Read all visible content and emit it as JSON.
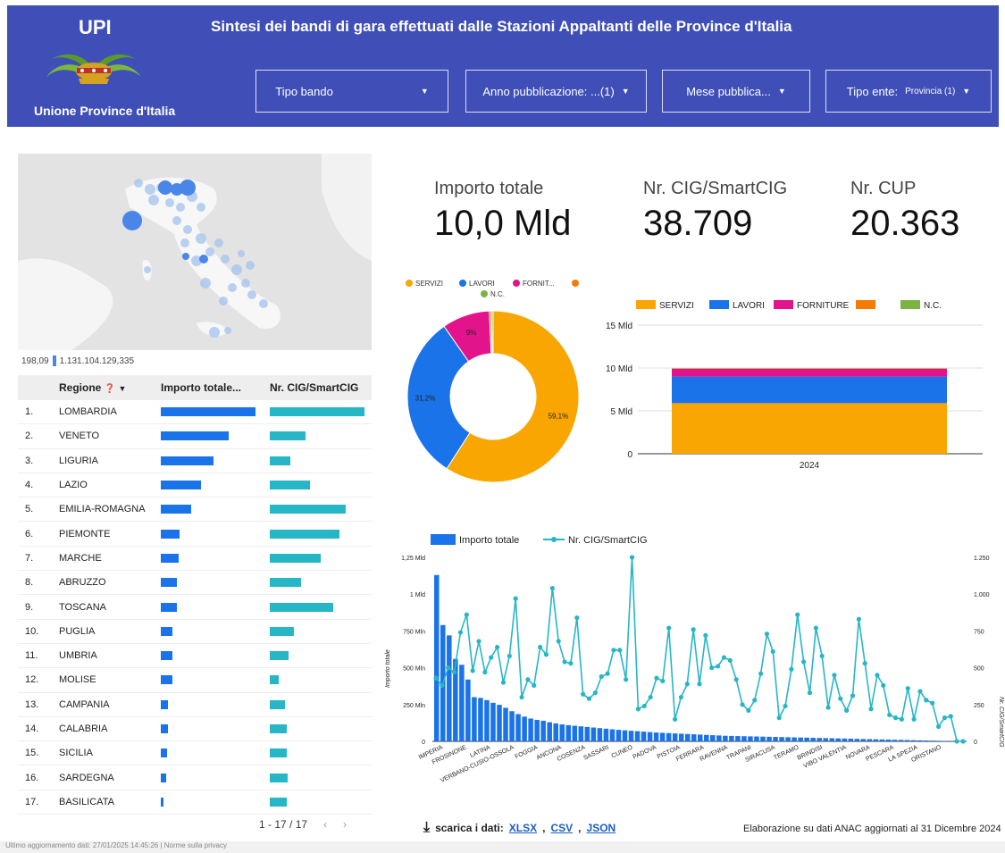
{
  "header": {
    "logo": "UPI",
    "logo_sub": "Unione Province d'Italia",
    "title": "Sintesi dei bandi di gara effettuati dalle Stazioni Appaltanti delle Province d'Italia",
    "filters": [
      {
        "label": "Tipo bando",
        "value": ""
      },
      {
        "label": "Anno pubblicazione: ...(1)",
        "value": ""
      },
      {
        "label": "Mese pubblica...",
        "value": ""
      },
      {
        "label": "Tipo ente:",
        "value": "Provincia (1)"
      }
    ]
  },
  "map": {
    "scale_min": "198,09",
    "scale_max": "1.131.104.129,335"
  },
  "table": {
    "headers": [
      "Regione",
      "Importo totale...",
      "Nr. CIG/SmartCIG"
    ],
    "rows": [
      {
        "n": "1.",
        "regione": "LOMBARDIA",
        "imp": 1.0,
        "cig": 1.0
      },
      {
        "n": "2.",
        "regione": "VENETO",
        "imp": 0.72,
        "cig": 0.38
      },
      {
        "n": "3.",
        "regione": "LIGURIA",
        "imp": 0.56,
        "cig": 0.22
      },
      {
        "n": "4.",
        "regione": "LAZIO",
        "imp": 0.42,
        "cig": 0.42
      },
      {
        "n": "5.",
        "regione": "EMILIA-ROMAGNA",
        "imp": 0.32,
        "cig": 0.8
      },
      {
        "n": "6.",
        "regione": "PIEMONTE",
        "imp": 0.2,
        "cig": 0.74
      },
      {
        "n": "7.",
        "regione": "MARCHE",
        "imp": 0.19,
        "cig": 0.54
      },
      {
        "n": "8.",
        "regione": "ABRUZZO",
        "imp": 0.17,
        "cig": 0.33
      },
      {
        "n": "9.",
        "regione": "TOSCANA",
        "imp": 0.17,
        "cig": 0.67
      },
      {
        "n": "10.",
        "regione": "PUGLIA",
        "imp": 0.12,
        "cig": 0.25
      },
      {
        "n": "11.",
        "regione": "UMBRIA",
        "imp": 0.12,
        "cig": 0.2
      },
      {
        "n": "12.",
        "regione": "MOLISE",
        "imp": 0.12,
        "cig": 0.09
      },
      {
        "n": "13.",
        "regione": "CAMPANIA",
        "imp": 0.08,
        "cig": 0.16
      },
      {
        "n": "14.",
        "regione": "CALABRIA",
        "imp": 0.08,
        "cig": 0.18
      },
      {
        "n": "15.",
        "regione": "SICILIA",
        "imp": 0.07,
        "cig": 0.18
      },
      {
        "n": "16.",
        "regione": "SARDEGNA",
        "imp": 0.06,
        "cig": 0.19
      },
      {
        "n": "17.",
        "regione": "BASILICATA",
        "imp": 0.03,
        "cig": 0.18
      }
    ],
    "pager": "1 - 17 / 17"
  },
  "kpis": [
    {
      "label": "Importo totale",
      "value": "10,0 Mld"
    },
    {
      "label": "Nr. CIG/SmartCIG",
      "value": "38.709"
    },
    {
      "label": "Nr. CUP",
      "value": "20.363"
    }
  ],
  "colors": {
    "servizi": "#f9a602",
    "lavori": "#1a73e8",
    "forniture": "#e3148b",
    "other": "#f57c00",
    "nc": "#7cb342",
    "teal": "#26b6c6",
    "header": "#3f4fb7"
  },
  "chart_data": [
    {
      "type": "pie",
      "legend": [
        "SERVIZI",
        "LAVORI",
        "FORNIT...",
        "",
        "N.C."
      ],
      "slices": [
        {
          "name": "SERVIZI",
          "value": 59.1,
          "label": "59,1%"
        },
        {
          "name": "LAVORI",
          "value": 31.2,
          "label": "31,2%"
        },
        {
          "name": "FORNITURE",
          "value": 9.0,
          "label": "9%"
        },
        {
          "name": "",
          "value": 0.4,
          "label": ""
        },
        {
          "name": "N.C.",
          "value": 0.3,
          "label": ""
        }
      ]
    },
    {
      "type": "bar",
      "legend": [
        "SERVIZI",
        "LAVORI",
        "FORNITURE",
        "",
        "N.C."
      ],
      "categories": [
        "2024"
      ],
      "series": [
        {
          "name": "SERVIZI",
          "values": [
            5.9
          ]
        },
        {
          "name": "LAVORI",
          "values": [
            3.1
          ]
        },
        {
          "name": "FORNITURE",
          "values": [
            0.9
          ]
        },
        {
          "name": "",
          "values": [
            0.04
          ]
        },
        {
          "name": "N.C.",
          "values": [
            0.03
          ]
        }
      ],
      "yticks": [
        "0",
        "5 Mld",
        "10 Mld",
        "15 Mld"
      ],
      "ylim": [
        0,
        15
      ]
    },
    {
      "type": "bar",
      "legend": [
        "Importo totale",
        "Nr. CIG/SmartCIG"
      ],
      "ylabel": "Importo totale",
      "y2label": "Nr. CIG/SmartCIG",
      "yticks": [
        "0",
        "250 Mln",
        "500 Mln",
        "750 Mln",
        "1 Mld",
        "1,25 Mld"
      ],
      "y2ticks": [
        "0",
        "250",
        "500",
        "750",
        "1.000",
        "1.250"
      ],
      "xlabels": [
        "IMPERIA",
        "FROSINONE",
        "LATINA",
        "VERBANO-CUSIO-OSSOLA",
        "FOGGIA",
        "ANCONA",
        "COSENZA",
        "SASSARI",
        "CUNEO",
        "PADOVA",
        "PISTOIA",
        "FERRARA",
        "RAVENNA",
        "TRAPANI",
        "SIRACUSA",
        "TERAMO",
        "BRINDISI",
        "VIBO VALENTIA",
        "NOVARA",
        "PESCARA",
        "LA SPEZIA",
        "ORISTANO"
      ],
      "bars": [
        1130,
        790,
        720,
        560,
        520,
        420,
        300,
        295,
        280,
        262,
        248,
        228,
        205,
        185,
        168,
        155,
        146,
        140,
        130,
        122,
        115,
        110,
        106,
        102,
        98,
        94,
        90,
        86,
        82,
        78,
        75,
        72,
        69,
        66,
        63,
        60,
        58,
        56,
        54,
        52,
        50,
        48,
        46,
        44,
        42,
        40,
        38,
        37,
        36,
        35,
        34,
        33,
        32,
        31,
        30,
        29,
        28,
        27,
        26,
        25,
        24,
        23,
        22,
        21,
        20,
        19,
        18,
        17,
        16,
        15,
        14,
        13,
        12,
        11,
        10,
        9,
        8,
        7,
        6,
        5,
        4,
        3,
        2,
        1
      ],
      "line": [
        430,
        380,
        500,
        470,
        740,
        860,
        480,
        680,
        470,
        570,
        640,
        400,
        580,
        970,
        300,
        420,
        380,
        640,
        590,
        1040,
        680,
        540,
        530,
        840,
        320,
        290,
        330,
        440,
        460,
        620,
        620,
        420,
        1250,
        220,
        240,
        300,
        430,
        410,
        770,
        150,
        300,
        390,
        760,
        390,
        720,
        500,
        510,
        570,
        550,
        420,
        250,
        210,
        280,
        460,
        730,
        610,
        160,
        240,
        490,
        860,
        540,
        330,
        770,
        580,
        230,
        450,
        290,
        210,
        310,
        830,
        530,
        220,
        450,
        380,
        180,
        160,
        150,
        360,
        150,
        340,
        280,
        260,
        100,
        160,
        170,
        0,
        0
      ]
    }
  ],
  "download": {
    "label": "scarica i dati:",
    "links": [
      "XLSX",
      "CSV",
      "JSON"
    ]
  },
  "note": "Elaborazione su dati ANAC aggiornati al 31 Dicembre 2024",
  "footer": "Ultimo aggiornamento dati: 27/01/2025 14:45:26 | Norme sulla privacy"
}
